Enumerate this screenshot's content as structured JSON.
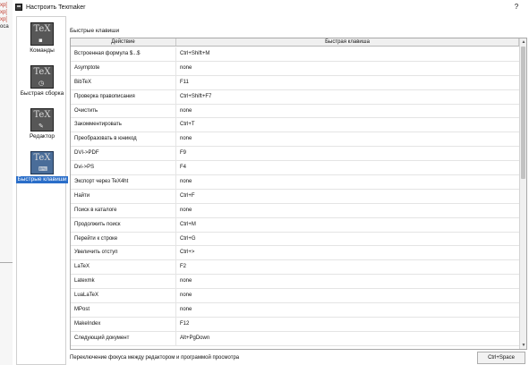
{
  "background_app": {
    "lines": [
      {
        "text": "xp[",
        "color": "#c0392b"
      },
      {
        "text": "xp[",
        "color": "#c0392b"
      },
      {
        "text": "xp[",
        "color": "#c0392b"
      },
      {
        "text": "oca",
        "color": "#222222"
      }
    ]
  },
  "window": {
    "title": "Настроить Texmaker",
    "help_label": "?"
  },
  "sidebar": {
    "items": [
      {
        "label": "Команды",
        "icon": "tex-commands-icon",
        "glyph": "▪",
        "active": false
      },
      {
        "label": "Быстрая сборка",
        "icon": "tex-quickbuild-icon",
        "glyph": "◷",
        "active": false
      },
      {
        "label": "Редактор",
        "icon": "tex-editor-icon",
        "glyph": "✎",
        "active": false
      },
      {
        "label": "Быстрые клавиши",
        "icon": "tex-shortcuts-icon",
        "glyph": "⌨",
        "active": true
      }
    ]
  },
  "shortcuts": {
    "section_title": "Быстрые клавиши",
    "columns": [
      "Действие",
      "Быстрая клавиша"
    ],
    "rows": [
      [
        "Встроенная формула $...$",
        "Ctrl+Shift+M"
      ],
      [
        "Asymptote",
        "none"
      ],
      [
        "BibTeX",
        "F11"
      ],
      [
        "Проверка правописания",
        "Ctrl+Shift+F7"
      ],
      [
        "Очистить",
        "none"
      ],
      [
        "Закомментировать",
        "Ctrl+T"
      ],
      [
        "Преобразовать в юникод",
        "none"
      ],
      [
        "DVI->PDF",
        "F9"
      ],
      [
        "Dvi->PS",
        "F4"
      ],
      [
        "Экспорт через TeX4ht",
        "none"
      ],
      [
        "Найти",
        "Ctrl+F"
      ],
      [
        "Поиск в каталоге",
        "none"
      ],
      [
        "Продолжить поиск",
        "Ctrl+M"
      ],
      [
        "Перейти к строке",
        "Ctrl+G"
      ],
      [
        "Увеличить отступ",
        "Ctrl+>"
      ],
      [
        "LaTeX",
        "F2"
      ],
      [
        "Latexmk",
        "none"
      ],
      [
        "LuaLaTeX",
        "none"
      ],
      [
        "MPost",
        "none"
      ],
      [
        "MakeIndex",
        "F12"
      ],
      [
        "Следующий документ",
        "Alt+PgDown"
      ]
    ]
  },
  "bottom": {
    "focus_label": "Переключение фокуса между редактором и программой просмотра",
    "focus_shortcut": "Ctrl+Space"
  },
  "scrollbar": {
    "up_arrow": "▲",
    "down_arrow": "▼"
  }
}
